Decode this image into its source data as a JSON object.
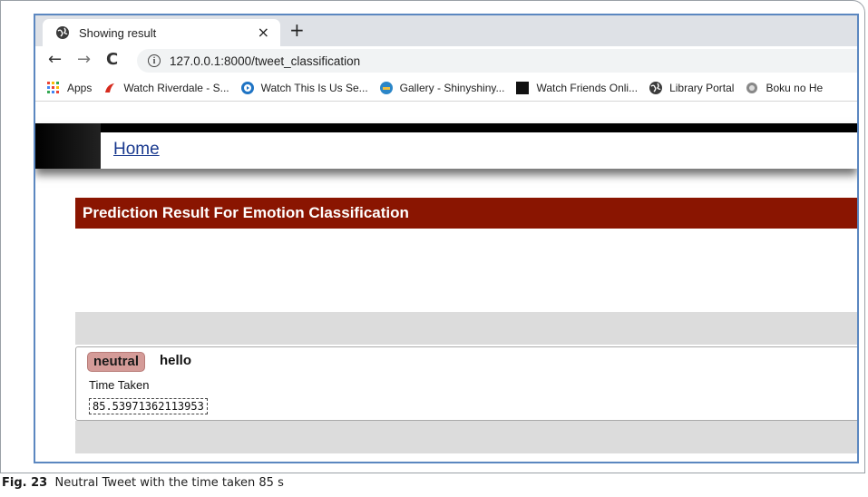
{
  "browser": {
    "tab_title": "Showing result",
    "tab_close": "×",
    "new_tab": "+",
    "url": "127.0.0.1:8000/tweet_classification",
    "bookmarks": [
      {
        "label": "Apps",
        "icon": "apps-grid-icon"
      },
      {
        "label": "Watch Riverdale - S...",
        "icon": "riverdale-icon"
      },
      {
        "label": "Watch This Is Us Se...",
        "icon": "play-circle-icon"
      },
      {
        "label": "Gallery - Shinyshiny...",
        "icon": "gallery-icon"
      },
      {
        "label": "Watch Friends Onli...",
        "icon": "black-square-icon"
      },
      {
        "label": "Library Portal",
        "icon": "globe-icon"
      },
      {
        "label": "Boku no He",
        "icon": "boku-icon"
      }
    ]
  },
  "page": {
    "nav_home": "Home",
    "banner_title": "Prediction Result For Emotion Classification",
    "result": {
      "label": "neutral",
      "tweet": "hello",
      "time_label": "Time Taken",
      "time_value": "85.53971362113953"
    }
  },
  "caption": {
    "fig": "Fig. 23",
    "text": "Neutral Tweet with the time taken 85 s"
  },
  "colors": {
    "banner": "#8a1501",
    "badge": "#d49b98",
    "frame_border": "#5b87c0"
  }
}
